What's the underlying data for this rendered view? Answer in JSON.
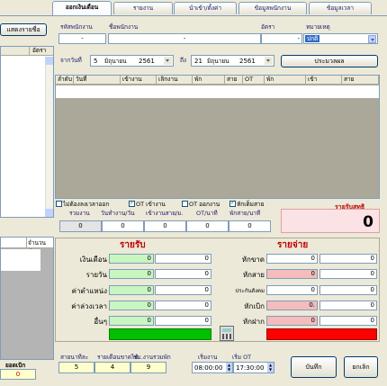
{
  "tabs": [
    {
      "label": "ออกเงินเดือน",
      "active": true
    },
    {
      "label": "รายงาน"
    },
    {
      "label": "นำเข้า/ตั้งค่า"
    },
    {
      "label": "ข้อมูลพนักงาน"
    },
    {
      "label": "ข้อมูลเวลา"
    }
  ],
  "left": {
    "list_button": "แสดงรายชื่อ",
    "rate_header": "อัตรา",
    "amount_header": "จำนวนเงิน",
    "withdraw_label": "ยอดเบิก",
    "withdraw_value": "0"
  },
  "employee": {
    "code_label": "รหัสพนักงาน",
    "name_label": "ชื่อพนักงาน",
    "code_value": "-",
    "name_value": "-",
    "rate_label": "อัตรา",
    "rate_value": "-",
    "note_label": "หมายเหตุ",
    "note_value": "ปกติ"
  },
  "date_range": {
    "from_label": "จากวันที่",
    "from_day": "5",
    "from_month": "มิถุนายน",
    "from_year": "2561",
    "to_label": "ถึง",
    "to_day": "21",
    "to_month": "มิถุนายน",
    "to_year": "2561",
    "process_button": "ประมวลผล"
  },
  "grid": {
    "columns": [
      "ลำดับ",
      "วันที่",
      "เข้างาน",
      "เลิกงาน",
      "พัก",
      "สาย",
      "OT",
      "พัก",
      "เข้า",
      "สาย"
    ]
  },
  "options": {
    "no_late_label": "ไม่ต้องลงเวลาออก",
    "no_late_checked": false,
    "ot_in_label": "OT เข้างาน",
    "ot_in_checked": true,
    "ot_out_label": "OT ออกงาน",
    "ot_out_checked": false,
    "late_deduct_label": "หักเต็มสาย",
    "late_deduct_checked": true
  },
  "summary_headers": {
    "total_work": "รวมงาน",
    "days_per_week": "วันทำงาน/วัน",
    "late_per_hr": "เข้างานสาย/ม.",
    "ot_per_min": "OT/นาที",
    "late_per_min": "พักสาย/นาที"
  },
  "summary_values": [
    "0",
    "0",
    "0",
    "0",
    "0"
  ],
  "net": {
    "label": "รายรับสุทธิ",
    "value": "0"
  },
  "income": {
    "title": "รายรับ",
    "rows": [
      {
        "label": "เงินเดือน",
        "value1": "0",
        "value2": "0"
      },
      {
        "label": "รายวัน",
        "value1": "0",
        "value2": "0"
      },
      {
        "label": "ค่าตำแหน่ง",
        "value1": "0",
        "value2": "0"
      },
      {
        "label": "ค่าล่วงเวลา",
        "value1": "0",
        "value2": "0"
      },
      {
        "label": "อื่นๆ",
        "value1": "0",
        "value2": "0"
      }
    ]
  },
  "expense": {
    "title": "รายจ่าย",
    "rows": [
      {
        "label": "หักขาด",
        "value1": "0",
        "value2": "0"
      },
      {
        "label": "หักสาย",
        "value1": "0",
        "value2": "0"
      },
      {
        "label": "ประกันสังคม",
        "value1": "0",
        "value2": "0"
      },
      {
        "label": "หักเบิก",
        "value1": "0.",
        "value2": "0"
      },
      {
        "label": "หักฝาก",
        "value1": "0",
        "value2": "0"
      }
    ]
  },
  "bottom": {
    "sum_late_label": "สายนาทีละ",
    "sum_late_value": "5",
    "deduct_label": "รายเดือนขาดได้",
    "deduct_value": "4",
    "hours_label": "ชม.งานรวมพัก",
    "hours_value": "9",
    "start_label": "เริ่มงาน",
    "start_value": "08:00:00",
    "ot_start_label": "เริ่ม OT",
    "ot_start_value": "17:30:00",
    "save_button": "บันทึก",
    "cancel_button": "ยกเลิก"
  },
  "colors": {
    "income_green": "#c8f5c0",
    "expense_pink": "#f4bcbc",
    "net_pink": "#fbe3e5",
    "total_green": "#00c000",
    "total_red": "#ff0000",
    "bottom_yellow": "#ffffcc"
  }
}
